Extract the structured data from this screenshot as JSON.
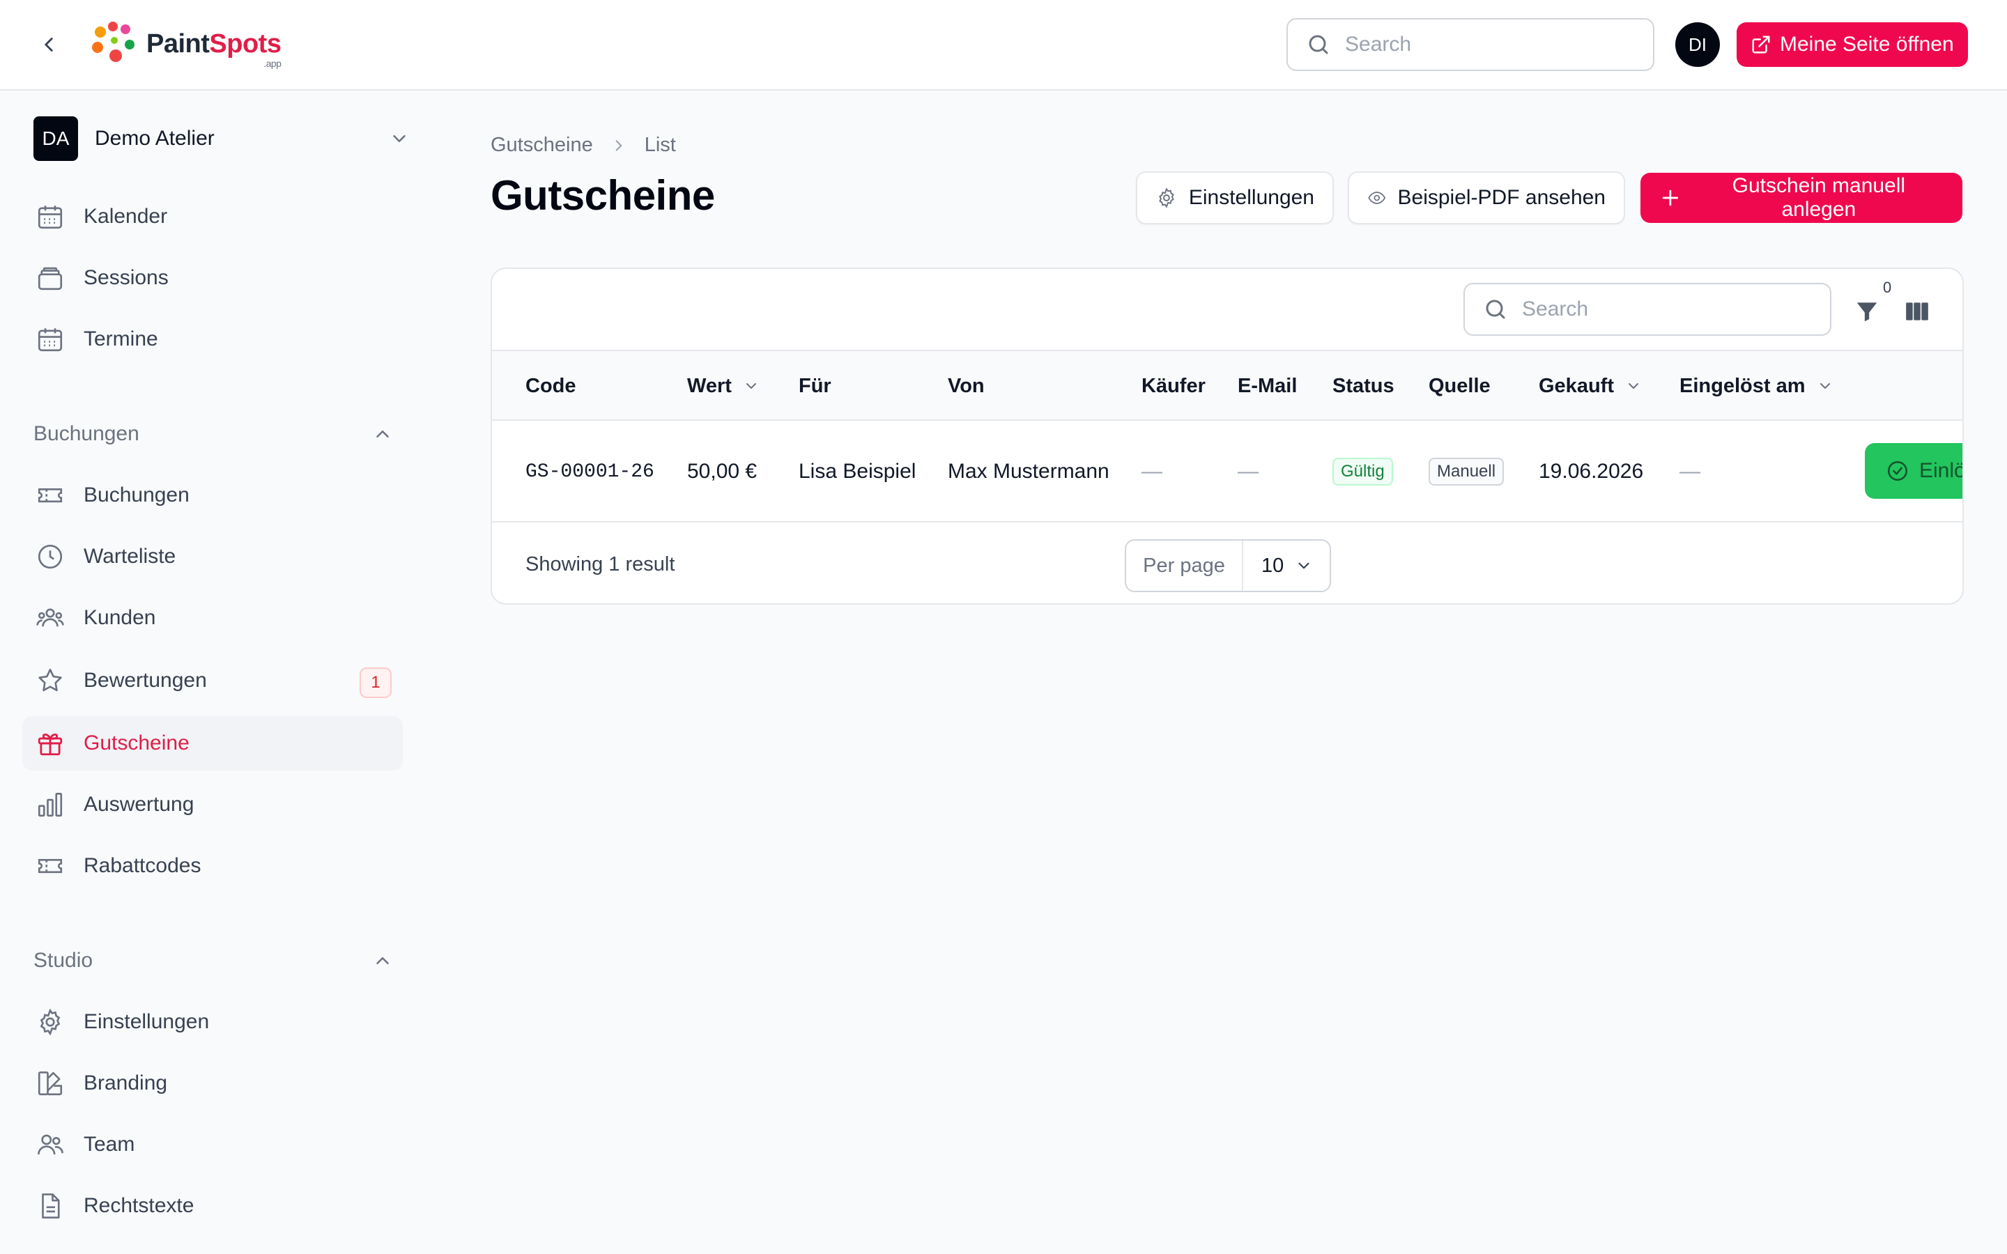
{
  "header": {
    "logo": {
      "part1": "Paint",
      "part2": "Spots",
      "suffix": ".app"
    },
    "search_placeholder": "Search",
    "user_initials": "DI",
    "open_site_label": "Meine Seite öffnen"
  },
  "sidebar": {
    "tenant": {
      "initials": "DA",
      "name": "Demo Atelier"
    },
    "items_top": [
      {
        "label": "Kalender",
        "icon": "calendar-icon"
      },
      {
        "label": "Sessions",
        "icon": "layers-icon"
      },
      {
        "label": "Termine",
        "icon": "calendar-icon"
      }
    ],
    "group_bookings": {
      "label": "Buchungen",
      "items": [
        {
          "label": "Buchungen",
          "icon": "ticket-icon"
        },
        {
          "label": "Warteliste",
          "icon": "clock-icon"
        },
        {
          "label": "Kunden",
          "icon": "users-icon"
        },
        {
          "label": "Bewertungen",
          "icon": "star-icon",
          "badge": "1"
        },
        {
          "label": "Gutscheine",
          "icon": "gift-icon",
          "active": true
        },
        {
          "label": "Auswertung",
          "icon": "chart-icon"
        },
        {
          "label": "Rabattcodes",
          "icon": "ticket-icon"
        }
      ]
    },
    "group_studio": {
      "label": "Studio",
      "items": [
        {
          "label": "Einstellungen",
          "icon": "gear-icon"
        },
        {
          "label": "Branding",
          "icon": "swatch-icon"
        },
        {
          "label": "Team",
          "icon": "users-icon"
        },
        {
          "label": "Rechtstexte",
          "icon": "document-icon"
        }
      ]
    }
  },
  "main": {
    "breadcrumb": [
      "Gutscheine",
      "List"
    ],
    "title": "Gutscheine",
    "actions": {
      "settings": "Einstellungen",
      "pdf": "Beispiel-PDF ansehen",
      "create": "Gutschein manuell anlegen"
    },
    "table": {
      "search_placeholder": "Search",
      "filter_count": "0",
      "columns": [
        "Code",
        "Wert",
        "Für",
        "Von",
        "Käufer",
        "E-Mail",
        "Status",
        "Quelle",
        "Gekauft",
        "Eingelöst am"
      ],
      "rows": [
        {
          "code": "GS-00001-26",
          "wert": "50,00 €",
          "fuer": "Lisa Beispiel",
          "von": "Max Mustermann",
          "kaeufer": "—",
          "email": "—",
          "status": "Gültig",
          "quelle": "Manuell",
          "gekauft": "19.06.2026",
          "eingeloest": "—",
          "action": "Einlö"
        }
      ],
      "result_text": "Showing 1 result",
      "per_page_label": "Per page",
      "per_page_value": "10"
    }
  },
  "colors": {
    "accent": "#f0084e",
    "active_nav": "#e11d48",
    "success": "#22c55e"
  }
}
